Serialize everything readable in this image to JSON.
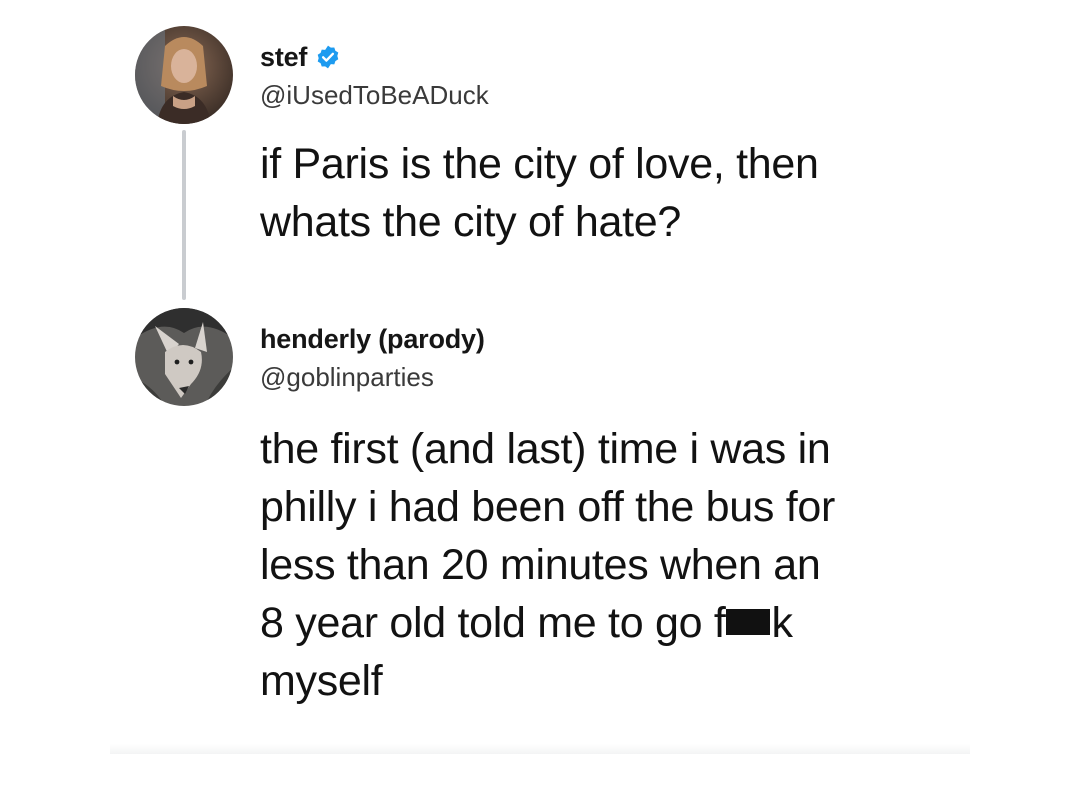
{
  "tweets": [
    {
      "display_name": "stef",
      "verified": true,
      "handle": "@iUsedToBeADuck",
      "text_lines": [
        "if Paris is the city of love, then",
        "whats the city of hate?"
      ],
      "avatar_icon": "woman-portrait-avatar"
    },
    {
      "display_name": "henderly (parody)",
      "verified": false,
      "handle": "@goblinparties",
      "text_lines": [
        "the first (and last) time i was in",
        "philly i had been off the bus for",
        "less than 20 minutes when an",
        "8 year old told me to go f",
        "myself"
      ],
      "censored_word_tail": "k",
      "avatar_icon": "coyote-drawing-avatar"
    }
  ],
  "colors": {
    "verified_badge": "#1d9bf0",
    "thread_line": "#c9ccd0",
    "text": "#121212"
  }
}
